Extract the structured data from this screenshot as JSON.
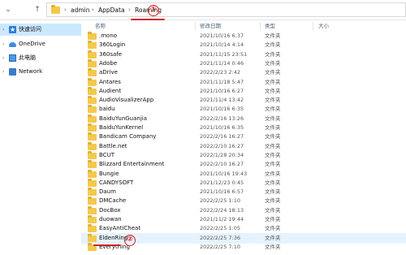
{
  "address_bar": {
    "crumbs": [
      "admin",
      "AppData",
      "Roaming"
    ],
    "separator": "›"
  },
  "nav": {
    "up_arrow": "↑"
  },
  "annotations": {
    "one": "①",
    "two": "②"
  },
  "sidebar": {
    "items": [
      {
        "label": "快速访问",
        "icon": "quick-access-star-icon",
        "selected": true
      },
      {
        "label": "OneDrive",
        "icon": "cloud-icon"
      },
      {
        "label": "此电脑",
        "icon": "computer-icon"
      },
      {
        "label": "Network",
        "icon": "network-icon"
      }
    ]
  },
  "columns": {
    "name": "名称",
    "date": "修改日期",
    "type": "类型",
    "size": "大小"
  },
  "files": [
    {
      "name": ".mono",
      "date": "2021/10/16 6:37",
      "type": "文件夹"
    },
    {
      "name": "360Login",
      "date": "2021/10/14 4:14",
      "type": "文件夹"
    },
    {
      "name": "360safe",
      "date": "2021/11/15 23:51",
      "type": "文件夹"
    },
    {
      "name": "Adobe",
      "date": "2021/11/14 0:46",
      "type": "文件夹"
    },
    {
      "name": "aDrive",
      "date": "2022/2/23 2:42",
      "type": "文件夹"
    },
    {
      "name": "Antares",
      "date": "2021/11/18 5:47",
      "type": "文件夹"
    },
    {
      "name": "Audient",
      "date": "2021/10/16 6:27",
      "type": "文件夹"
    },
    {
      "name": "AudioVisualizerApp",
      "date": "2021/11/4 13:42",
      "type": "文件夹"
    },
    {
      "name": "baidu",
      "date": "2021/10/16 6:35",
      "type": "文件夹"
    },
    {
      "name": "BaiduYunGuanjia",
      "date": "2022/2/16 13:26",
      "type": "文件夹"
    },
    {
      "name": "BaiduYunKernel",
      "date": "2021/10/16 6:35",
      "type": "文件夹"
    },
    {
      "name": "Bandicam Company",
      "date": "2022/2/16 16:27",
      "type": "文件夹"
    },
    {
      "name": "Battle.net",
      "date": "2022/2/10 16:27",
      "type": "文件夹"
    },
    {
      "name": "BCUT",
      "date": "2022/1/28 20:34",
      "type": "文件夹"
    },
    {
      "name": "Blizzard Entertainment",
      "date": "2022/2/10 16:27",
      "type": "文件夹"
    },
    {
      "name": "Bungie",
      "date": "2021/10/16 19:43",
      "type": "文件夹"
    },
    {
      "name": "CANDYSOFT",
      "date": "2021/12/23 0:45",
      "type": "文件夹"
    },
    {
      "name": "Daum",
      "date": "2021/10/16 6:57",
      "type": "文件夹"
    },
    {
      "name": "DMCache",
      "date": "2022/2/25 1:10",
      "type": "文件夹"
    },
    {
      "name": "DocBox",
      "date": "2022/2/24 18:13",
      "type": "文件夹"
    },
    {
      "name": "duowan",
      "date": "2021/11/2 19:44",
      "type": "文件夹"
    },
    {
      "name": "EasyAntiCheat",
      "date": "2022/2/25 1:05",
      "type": "文件夹"
    },
    {
      "name": "EldenRing",
      "date": "2022/2/25 7:36",
      "type": "文件夹",
      "highlighted": true
    },
    {
      "name": "Everything",
      "date": "2022/2/25 7:10",
      "type": "文件夹"
    }
  ]
}
